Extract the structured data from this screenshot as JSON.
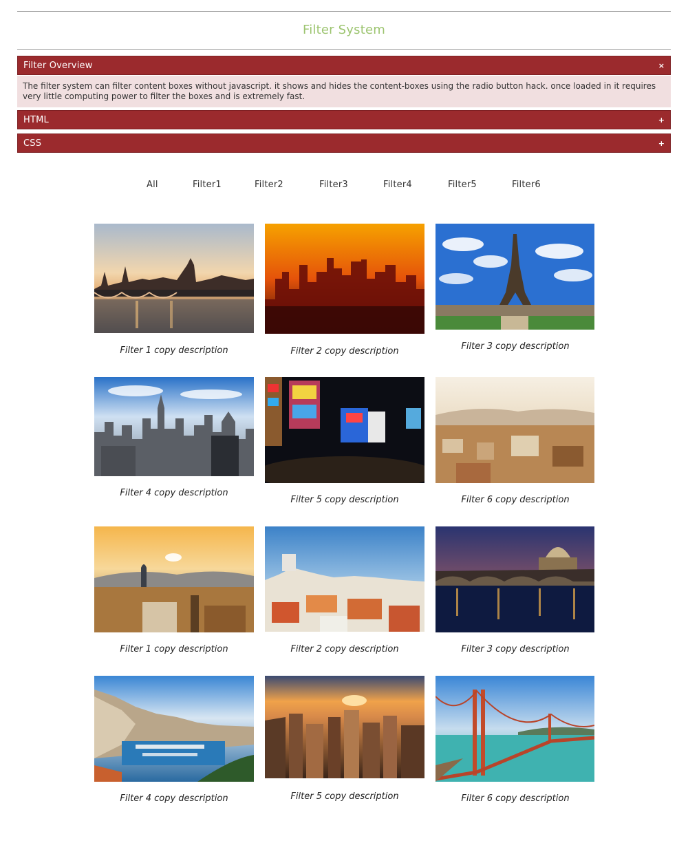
{
  "header": {
    "title": "Filter System"
  },
  "accordion": [
    {
      "label": "Filter Overview",
      "icon": "×",
      "icon_name": "close-icon",
      "body": "The filter system can filter content boxes without javascript. it shows and hides the content-boxes using the radio button hack. once loaded in it requires very little computing power to filter the boxes and is extremely fast."
    },
    {
      "label": "HTML",
      "icon": "+",
      "icon_name": "plus-icon"
    },
    {
      "label": "CSS",
      "icon": "+",
      "icon_name": "plus-icon"
    }
  ],
  "filters": [
    "All",
    "Filter1",
    "Filter2",
    "Filter3",
    "Filter4",
    "Filter5",
    "Filter6"
  ],
  "gallery": [
    {
      "caption": "Filter 1 copy description",
      "photo": "london-bridge-sunset"
    },
    {
      "caption": "Filter 2 copy description",
      "photo": "orange-city-skyline"
    },
    {
      "caption": "Filter 3 copy description",
      "photo": "eiffel-tower"
    },
    {
      "caption": "Filter 4 copy description",
      "photo": "new-york-skyline"
    },
    {
      "caption": "Filter 5 copy description",
      "photo": "neon-night-crossing"
    },
    {
      "caption": "Filter 6 copy description",
      "photo": "hazy-old-town"
    },
    {
      "caption": "Filter 1 copy description",
      "photo": "barcelona-sunset"
    },
    {
      "caption": "Filter 2 copy description",
      "photo": "lisbon-rooftops"
    },
    {
      "caption": "Filter 3 copy description",
      "photo": "rome-river-night"
    },
    {
      "caption": "Filter 4 copy description",
      "photo": "monaco-harbor"
    },
    {
      "caption": "Filter 5 copy description",
      "photo": "city-aerial-sunset"
    },
    {
      "caption": "Filter 6 copy description",
      "photo": "golden-gate-bridge"
    }
  ],
  "colors": {
    "title": "#9cc46f",
    "accordion_header": "#9b2a2d",
    "accordion_body": "#f1dfe0"
  }
}
